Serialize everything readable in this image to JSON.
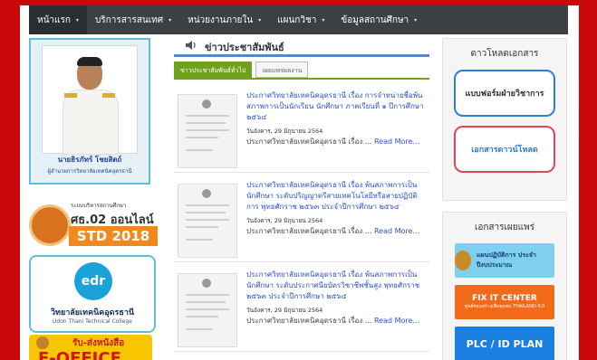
{
  "nav": {
    "items": [
      {
        "label": "หน้าแรก",
        "caret": "▾",
        "active": true
      },
      {
        "label": "บริการสารสนเทศ",
        "caret": "▾"
      },
      {
        "label": "หน่วยงานภายใน",
        "caret": "▾"
      },
      {
        "label": "แผนกวิชา",
        "caret": "▾"
      },
      {
        "label": "ข้อมูลสถานศึกษา",
        "caret": "▾"
      }
    ]
  },
  "left": {
    "director_name": "นายธิรภัทร์ โชยสิตถ์",
    "director_title": "ผู้อำนวยการวิทยาลัยเทคนิคอุดรธานี",
    "std_line1": "ระบบบริหารสถานศึกษา",
    "std_line2": "ศธ.02 ออนไลน์",
    "std_line3": "STD 2018",
    "edr_logo": "edr",
    "edr_line1": "วิทยาลัยเทคนิคอุดรธานี",
    "edr_line2": "Udon Thani Technical College",
    "office_line1": "รับ-ส่งหนังสือ",
    "office_line2": "E-OFFICE"
  },
  "main": {
    "section_title": "ข่าวประชาสัมพันธ์",
    "tabs": [
      {
        "label": "ข่าวประชาสัมพันธ์ทั่วไป",
        "active": true
      },
      {
        "label": "เผยแพร่ผลงาน",
        "active": false
      }
    ],
    "news": [
      {
        "title": "ประกาศวิทยาลัยเทคนิคอุดรธานี เรื่อง การจำหน่ายชื่อพ้นสภาพการเป็นนักเรียน นักศึกษา ภาคเรียนที่ ๑ ปีการศึกษา ๒๕๖๔",
        "date": "วันอังคาร, 29 มิถุนายน 2564",
        "excerpt": "ประกาศวิทยาลัยเทคนิคอุดรธานี เรื่อง ...",
        "more": "Read More..."
      },
      {
        "title": "ประกาศวิทยาลัยเทคนิคอุดรธานี เรื่อง พ้นสภาพการเป็นนักศึกษา ระดับปริญญาตรีสายเทคโนโลยีหรือสายปฏิบัติการ พุทธศักราช ๒๕๖๓ ประจำปีการศึกษา ๒๕๖๔",
        "date": "วันอังคาร, 29 มิถุนายน 2564",
        "excerpt": "ประกาศวิทยาลัยเทคนิคอุดรธานี เรื่อง ...",
        "more": "Read More..."
      },
      {
        "title": "ประกาศวิทยาลัยเทคนิคอุดรธานี เรื่อง พ้นสภาพการเป็นนักศึกษา ระดับประกาศนียบัตรวิชาชีพชั้นสูง พุทธศักราช ๒๕๖๓ ประจำปีการศึกษา ๒๕๖๔",
        "date": "วันอังคาร, 29 มิถุนายน 2564",
        "excerpt": "ประกาศวิทยาลัยเทคนิคอุดรธานี เรื่อง ...",
        "more": "Read More..."
      }
    ]
  },
  "right": {
    "download_title": "ดาวโหลดเอกสาร",
    "download_buttons": [
      "แบบฟอร์มฝ่ายวิชาการ",
      "เอกสารดาวน์โหลด"
    ],
    "publish_title": "เอกสารเผยแพร่",
    "publish_items": [
      "แผนปฏิบัติการ ประจำปีงบประมาณ",
      "FIX IT CENTER",
      "PLC / ID PLAN"
    ],
    "fix_sub": "ศูนย์ซ่อมสร้างเพื่อชุมชน THAILAND 4.0"
  },
  "colors": {
    "background": "#c8080a",
    "nav": "#3c3f44",
    "link": "#2d4fd0",
    "tab_active": "#6fa21a",
    "accent_blue": "#2b7fd8",
    "accent_red": "#e0465a"
  }
}
